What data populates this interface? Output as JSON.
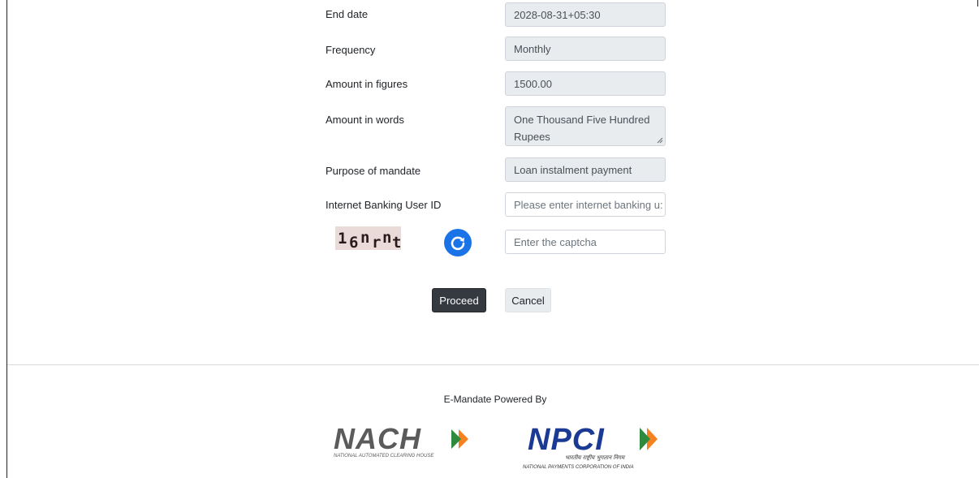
{
  "form": {
    "end_date": {
      "label": "End date",
      "value": "2028-08-31+05:30"
    },
    "frequency": {
      "label": "Frequency",
      "value": "Monthly"
    },
    "amount_figures": {
      "label": "Amount in figures",
      "value": "1500.00"
    },
    "amount_words": {
      "label": "Amount in words",
      "value": "One Thousand Five Hundred Rupees"
    },
    "purpose": {
      "label": "Purpose of mandate",
      "value": "Loan instalment payment"
    },
    "user_id": {
      "label": "Internet Banking User ID",
      "placeholder": "Please enter internet banking u:"
    },
    "captcha": {
      "text": "16nrnt",
      "chars": [
        "1",
        "6",
        "n",
        "r",
        "n",
        "t"
      ],
      "placeholder": "Enter the captcha",
      "refresh_icon": "refresh-icon"
    }
  },
  "actions": {
    "proceed_label": "Proceed",
    "cancel_label": "Cancel"
  },
  "footer": {
    "powered_by": "E-Mandate Powered By",
    "nach": {
      "wordmark": "NACH",
      "tagline": "NATIONAL AUTOMATED CLEARING HOUSE"
    },
    "npci": {
      "wordmark": "NPCI",
      "hindi": "भारतीय राष्ट्रीय भुगतान निगम",
      "tagline": "NATIONAL PAYMENTS CORPORATION OF INDIA"
    }
  },
  "colors": {
    "accent_orange": "#f58220",
    "logo_grey": "#5b5b5b",
    "npci_blue": "#1a3a93",
    "refresh_blue": "#1b73e8",
    "proceed_bg": "#343a40"
  }
}
